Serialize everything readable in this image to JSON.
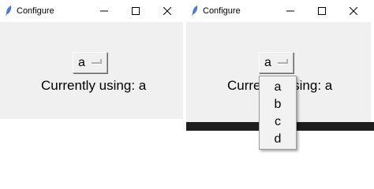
{
  "windows": [
    {
      "title": "Configure",
      "option_menu": {
        "selected": "a"
      },
      "status_text": "Currently using: a"
    },
    {
      "title": "Configure",
      "option_menu": {
        "selected": "a"
      },
      "status_text": "Currently using: a",
      "dropdown": {
        "options": [
          "a",
          "b",
          "c",
          "d"
        ]
      }
    }
  ],
  "icons": {
    "app": "feather-icon",
    "minimize": "minimize-icon",
    "maximize": "maximize-icon",
    "close": "close-icon"
  },
  "colors": {
    "client_bg": "#f0f0f0",
    "titlebar_bg": "#ffffff",
    "dark_bar": "#1e1e1e"
  }
}
